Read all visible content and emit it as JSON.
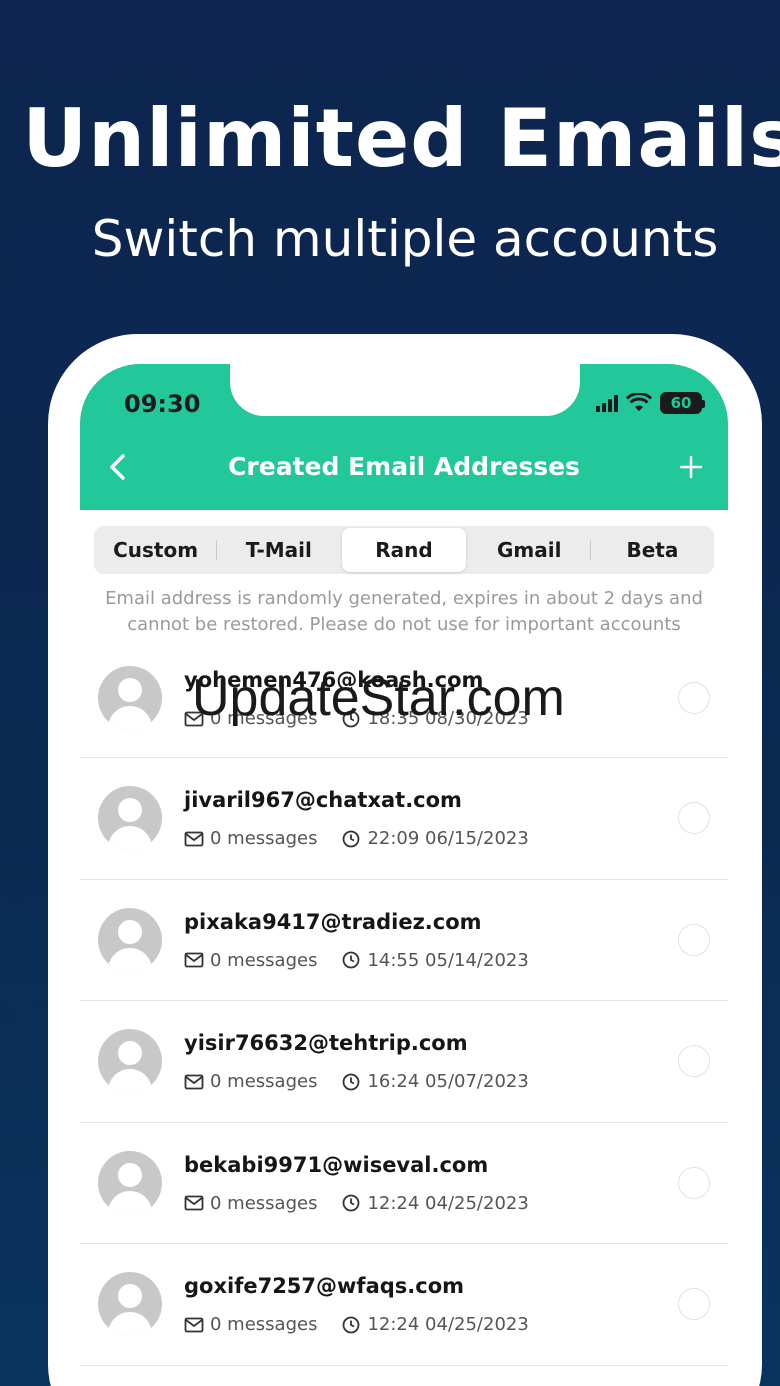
{
  "promo": {
    "headline": "Unlimited Emails",
    "subline": "Switch multiple accounts"
  },
  "status_bar": {
    "time": "09:30",
    "battery": "60"
  },
  "nav": {
    "title": "Created Email Addresses"
  },
  "tabs": [
    {
      "label": "Custom",
      "active": false
    },
    {
      "label": "T-Mail",
      "active": false
    },
    {
      "label": "Rand",
      "active": true
    },
    {
      "label": "Gmail",
      "active": false
    },
    {
      "label": "Beta",
      "active": false
    }
  ],
  "notice": "Email address is randomly generated, expires in about 2 days and cannot be restored. Please do not use for important accounts",
  "emails": [
    {
      "address": "yohemen476@koash.com",
      "messages": "0 messages",
      "datetime": "18:35 08/30/2023"
    },
    {
      "address": "jivaril967@chatxat.com",
      "messages": "0 messages",
      "datetime": "22:09 06/15/2023"
    },
    {
      "address": "pixaka9417@tradiez.com",
      "messages": "0 messages",
      "datetime": "14:55 05/14/2023"
    },
    {
      "address": "yisir76632@tehtrip.com",
      "messages": "0 messages",
      "datetime": "16:24 05/07/2023"
    },
    {
      "address": "bekabi9971@wiseval.com",
      "messages": "0 messages",
      "datetime": "12:24 04/25/2023"
    },
    {
      "address": "goxife7257@wfaqs.com",
      "messages": "0 messages",
      "datetime": "12:24 04/25/2023"
    }
  ],
  "watermark": "UpdateStar.com",
  "colors": {
    "accent": "#22c79a",
    "background": "#0d2550"
  }
}
